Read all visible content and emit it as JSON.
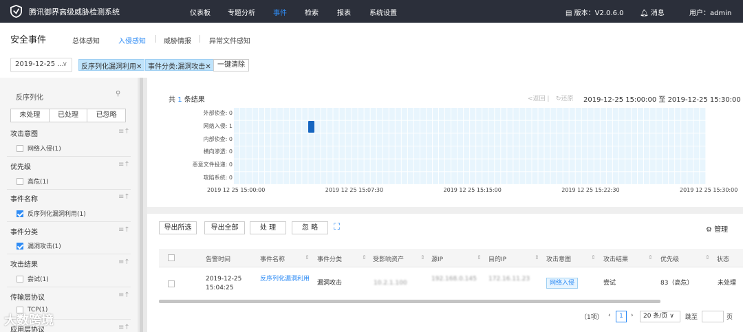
{
  "app": {
    "name": "腾讯御界高级威胁检测系统",
    "version": "版本：V2.0.6.0",
    "messages": "消息",
    "user": "用户：admin"
  },
  "nav": [
    "仪表板",
    "专题分析",
    "事件",
    "检索",
    "报表",
    "系统设置"
  ],
  "page": {
    "title": "安全事件",
    "tabs": [
      "总体感知",
      "入侵感知",
      "威胁情报",
      "异常文件感知"
    ]
  },
  "filters": {
    "date": "2019-12-25 ...",
    "chips": [
      "反序列化漏洞利用",
      "事件分类:漏洞攻击"
    ],
    "clear_all": "一键清除"
  },
  "sidebar": {
    "search_placeholder": "反序列化",
    "segments": [
      "未处理",
      "已处理",
      "已忽略"
    ],
    "facets": [
      {
        "title": "攻击意图",
        "option": "网络入侵(1)",
        "checked": false
      },
      {
        "title": "优先级",
        "option": "高危(1)",
        "checked": false
      },
      {
        "title": "事件名称",
        "option": "反序列化漏洞利用(1)",
        "checked": true
      },
      {
        "title": "事件分类",
        "option": "漏洞攻击(1)",
        "checked": true
      },
      {
        "title": "攻击结果",
        "option": "尝试(1)",
        "checked": false
      },
      {
        "title": "传输层协议",
        "option": "TCP(1)",
        "checked": false
      },
      {
        "title": "应用层协议",
        "option": "",
        "checked": false
      }
    ]
  },
  "watermark": "大数跨境",
  "results": {
    "prefix": "共",
    "count": "1",
    "suffix": "条结果",
    "back": "返回",
    "restore": "还原",
    "range": "2019-12-25 15:00:00 至 2019-12-25 15:30:00"
  },
  "chart_data": {
    "type": "heatmap",
    "rows": [
      {
        "label": "外部侦查",
        "value": 0
      },
      {
        "label": "网络入侵",
        "value": 1
      },
      {
        "label": "内部侦查",
        "value": 0
      },
      {
        "label": "横向渗透",
        "value": 0
      },
      {
        "label": "恶意文件投递",
        "value": 0
      },
      {
        "label": "攻陷系统",
        "value": 0
      }
    ],
    "x_ticks": [
      "2019 12 25 15:00:00",
      "2019 12 25 15:07:30",
      "2019 12 25 15:15:00",
      "2019 12 25 15:22:30",
      "2019 12 25 15:30:00"
    ],
    "columns": 76,
    "points": [
      {
        "row": "网络入侵",
        "column": 12,
        "value": 1
      }
    ],
    "colors": {
      "empty": "#e8f5fd",
      "filled": "#1565c0"
    }
  },
  "toolbar": {
    "export_selected": "导出所选",
    "export_all": "导出全部",
    "process": "处 理",
    "ignore": "忽 略",
    "manage": "管理"
  },
  "table": {
    "headers": [
      "告警时间",
      "事件名称",
      "事件分类",
      "受影响资产",
      "源IP",
      "目的IP",
      "攻击意图",
      "攻击结果",
      "优先级",
      "状态"
    ],
    "rows": [
      {
        "time": "2019-12-25 15:04:25",
        "name": "反序列化漏洞利用",
        "category": "漏洞攻击",
        "asset": "10.2.1.100",
        "src": "192.168.0.145",
        "dst": "172.16.11.23",
        "intent": "网络入侵",
        "result": "尝试",
        "priority": "83（高危）",
        "status": "未处理"
      }
    ]
  },
  "pagination": {
    "total": "（1项）",
    "page": "1",
    "page_size": "20 条/页",
    "jump_label": "跳至",
    "page_unit": "页"
  }
}
